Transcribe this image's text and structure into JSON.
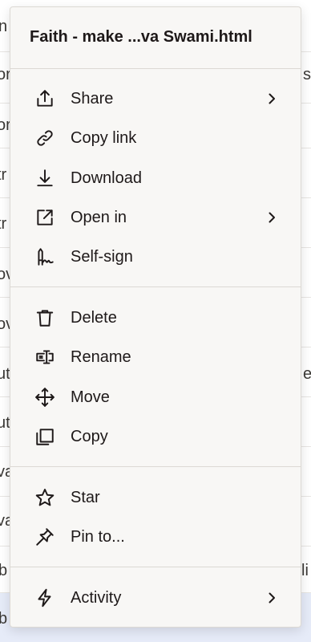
{
  "menu": {
    "title": "Faith - make ...va Swami.html",
    "sections": [
      {
        "items": [
          {
            "label": "Share",
            "icon": "share-icon",
            "submenu": true
          },
          {
            "label": "Copy link",
            "icon": "link-icon",
            "submenu": false
          },
          {
            "label": "Download",
            "icon": "download-icon",
            "submenu": false
          },
          {
            "label": "Open in",
            "icon": "open-external-icon",
            "submenu": true
          },
          {
            "label": "Self-sign",
            "icon": "signature-icon",
            "submenu": false
          }
        ]
      },
      {
        "items": [
          {
            "label": "Delete",
            "icon": "trash-icon",
            "submenu": false
          },
          {
            "label": "Rename",
            "icon": "rename-icon",
            "submenu": false
          },
          {
            "label": "Move",
            "icon": "move-icon",
            "submenu": false
          },
          {
            "label": "Copy",
            "icon": "copy-icon",
            "submenu": false
          }
        ]
      },
      {
        "items": [
          {
            "label": "Star",
            "icon": "star-icon",
            "submenu": false
          },
          {
            "label": "Pin to...",
            "icon": "pin-icon",
            "submenu": false
          }
        ]
      },
      {
        "items": [
          {
            "label": "Activity",
            "icon": "activity-icon",
            "submenu": true
          }
        ]
      }
    ]
  },
  "background": {
    "left_fragments": [
      "n",
      "or",
      "or",
      "tr",
      "tr",
      "ov",
      "ov",
      "ut",
      "ut",
      "va",
      "va",
      "b",
      "b"
    ],
    "right_fragments": [
      "s",
      "e",
      "li"
    ]
  },
  "colors": {
    "menu_bg": "#f8f7f5",
    "text": "#1e1919",
    "divider": "#dcd9d4",
    "selected_row": "#e6ebf8"
  }
}
